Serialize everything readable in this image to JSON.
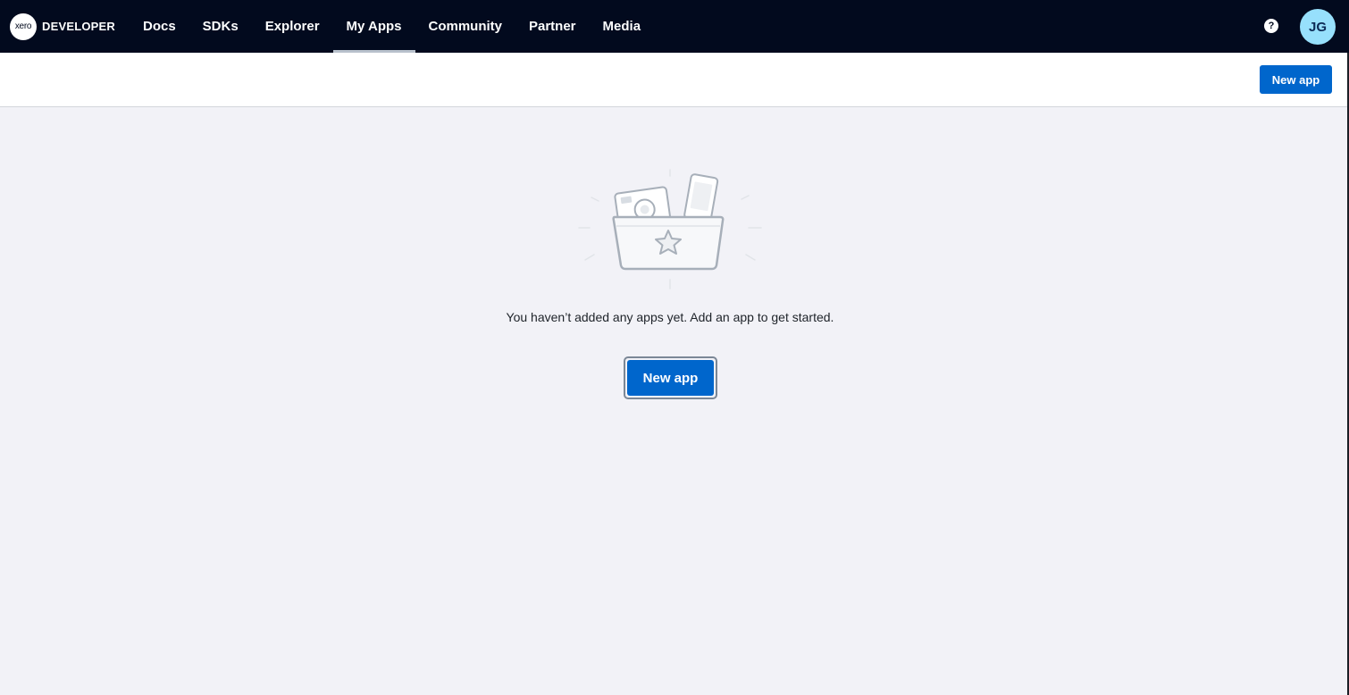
{
  "topnav": {
    "brand": {
      "logo_text": "xero",
      "label": "DEVELOPER"
    },
    "items": [
      {
        "label": "Docs",
        "active": false
      },
      {
        "label": "SDKs",
        "active": false
      },
      {
        "label": "Explorer",
        "active": false
      },
      {
        "label": "My Apps",
        "active": true
      },
      {
        "label": "Community",
        "active": false
      },
      {
        "label": "Partner",
        "active": false
      },
      {
        "label": "Media",
        "active": false
      }
    ],
    "help_icon": "question-mark-icon",
    "help_glyph": "?",
    "avatar_initials": "JG"
  },
  "header": {
    "new_app_label": "New app"
  },
  "empty_state": {
    "illustration_icon": "folder-with-star-icon",
    "message": "You haven’t added any apps yet. Add an app to get started.",
    "new_app_label": "New app"
  },
  "colors": {
    "nav_background": "#020a1e",
    "primary_button": "#0066cc",
    "page_background": "#f2f2f7",
    "avatar_background": "#97e0fc"
  }
}
